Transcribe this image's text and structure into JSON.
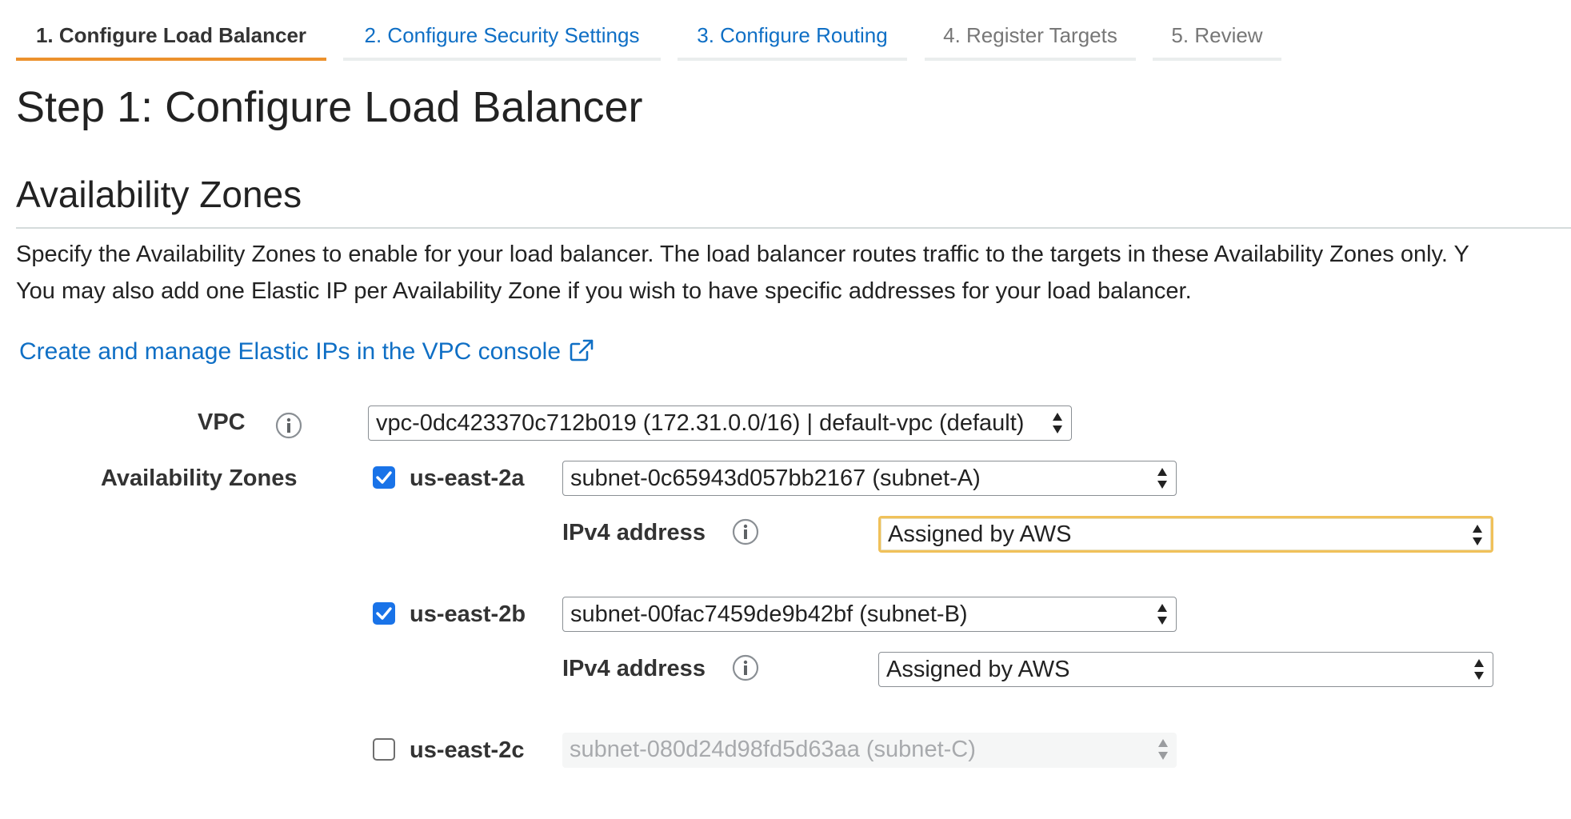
{
  "tabs": [
    {
      "label": "1. Configure Load Balancer",
      "state": "active"
    },
    {
      "label": "2. Configure Security Settings",
      "state": "link"
    },
    {
      "label": "3. Configure Routing",
      "state": "link"
    },
    {
      "label": "4. Register Targets",
      "state": "muted"
    },
    {
      "label": "5. Review",
      "state": "muted"
    }
  ],
  "step_title": "Step 1: Configure Load Balancer",
  "section": {
    "title": "Availability Zones",
    "description_line1": "Specify the Availability Zones to enable for your load balancer. The load balancer routes traffic to the targets in these Availability Zones only. Y",
    "description_line2": "You may also add one Elastic IP per Availability Zone if you wish to have specific addresses for your load balancer.",
    "eip_link": "Create and manage Elastic IPs in the VPC console"
  },
  "vpc": {
    "label": "VPC",
    "value": "vpc-0dc423370c712b019 (172.31.0.0/16) | default-vpc (default)"
  },
  "availability_zones": {
    "label": "Availability Zones",
    "ipv4_label": "IPv4 address",
    "zones": [
      {
        "name": "us-east-2a",
        "checked": true,
        "subnet": "subnet-0c65943d057bb2167 (subnet-A)",
        "ipv4": "Assigned by AWS"
      },
      {
        "name": "us-east-2b",
        "checked": true,
        "subnet": "subnet-00fac7459de9b42bf (subnet-B)",
        "ipv4": "Assigned by AWS"
      },
      {
        "name": "us-east-2c",
        "checked": false,
        "subnet": "subnet-080d24d98fd5d63aa (subnet-C)"
      }
    ]
  },
  "colors": {
    "link": "#0f6fc5",
    "active_tab_underline": "#ec912d",
    "checkbox": "#1973e8",
    "focus_ring": "#f0c15a"
  }
}
